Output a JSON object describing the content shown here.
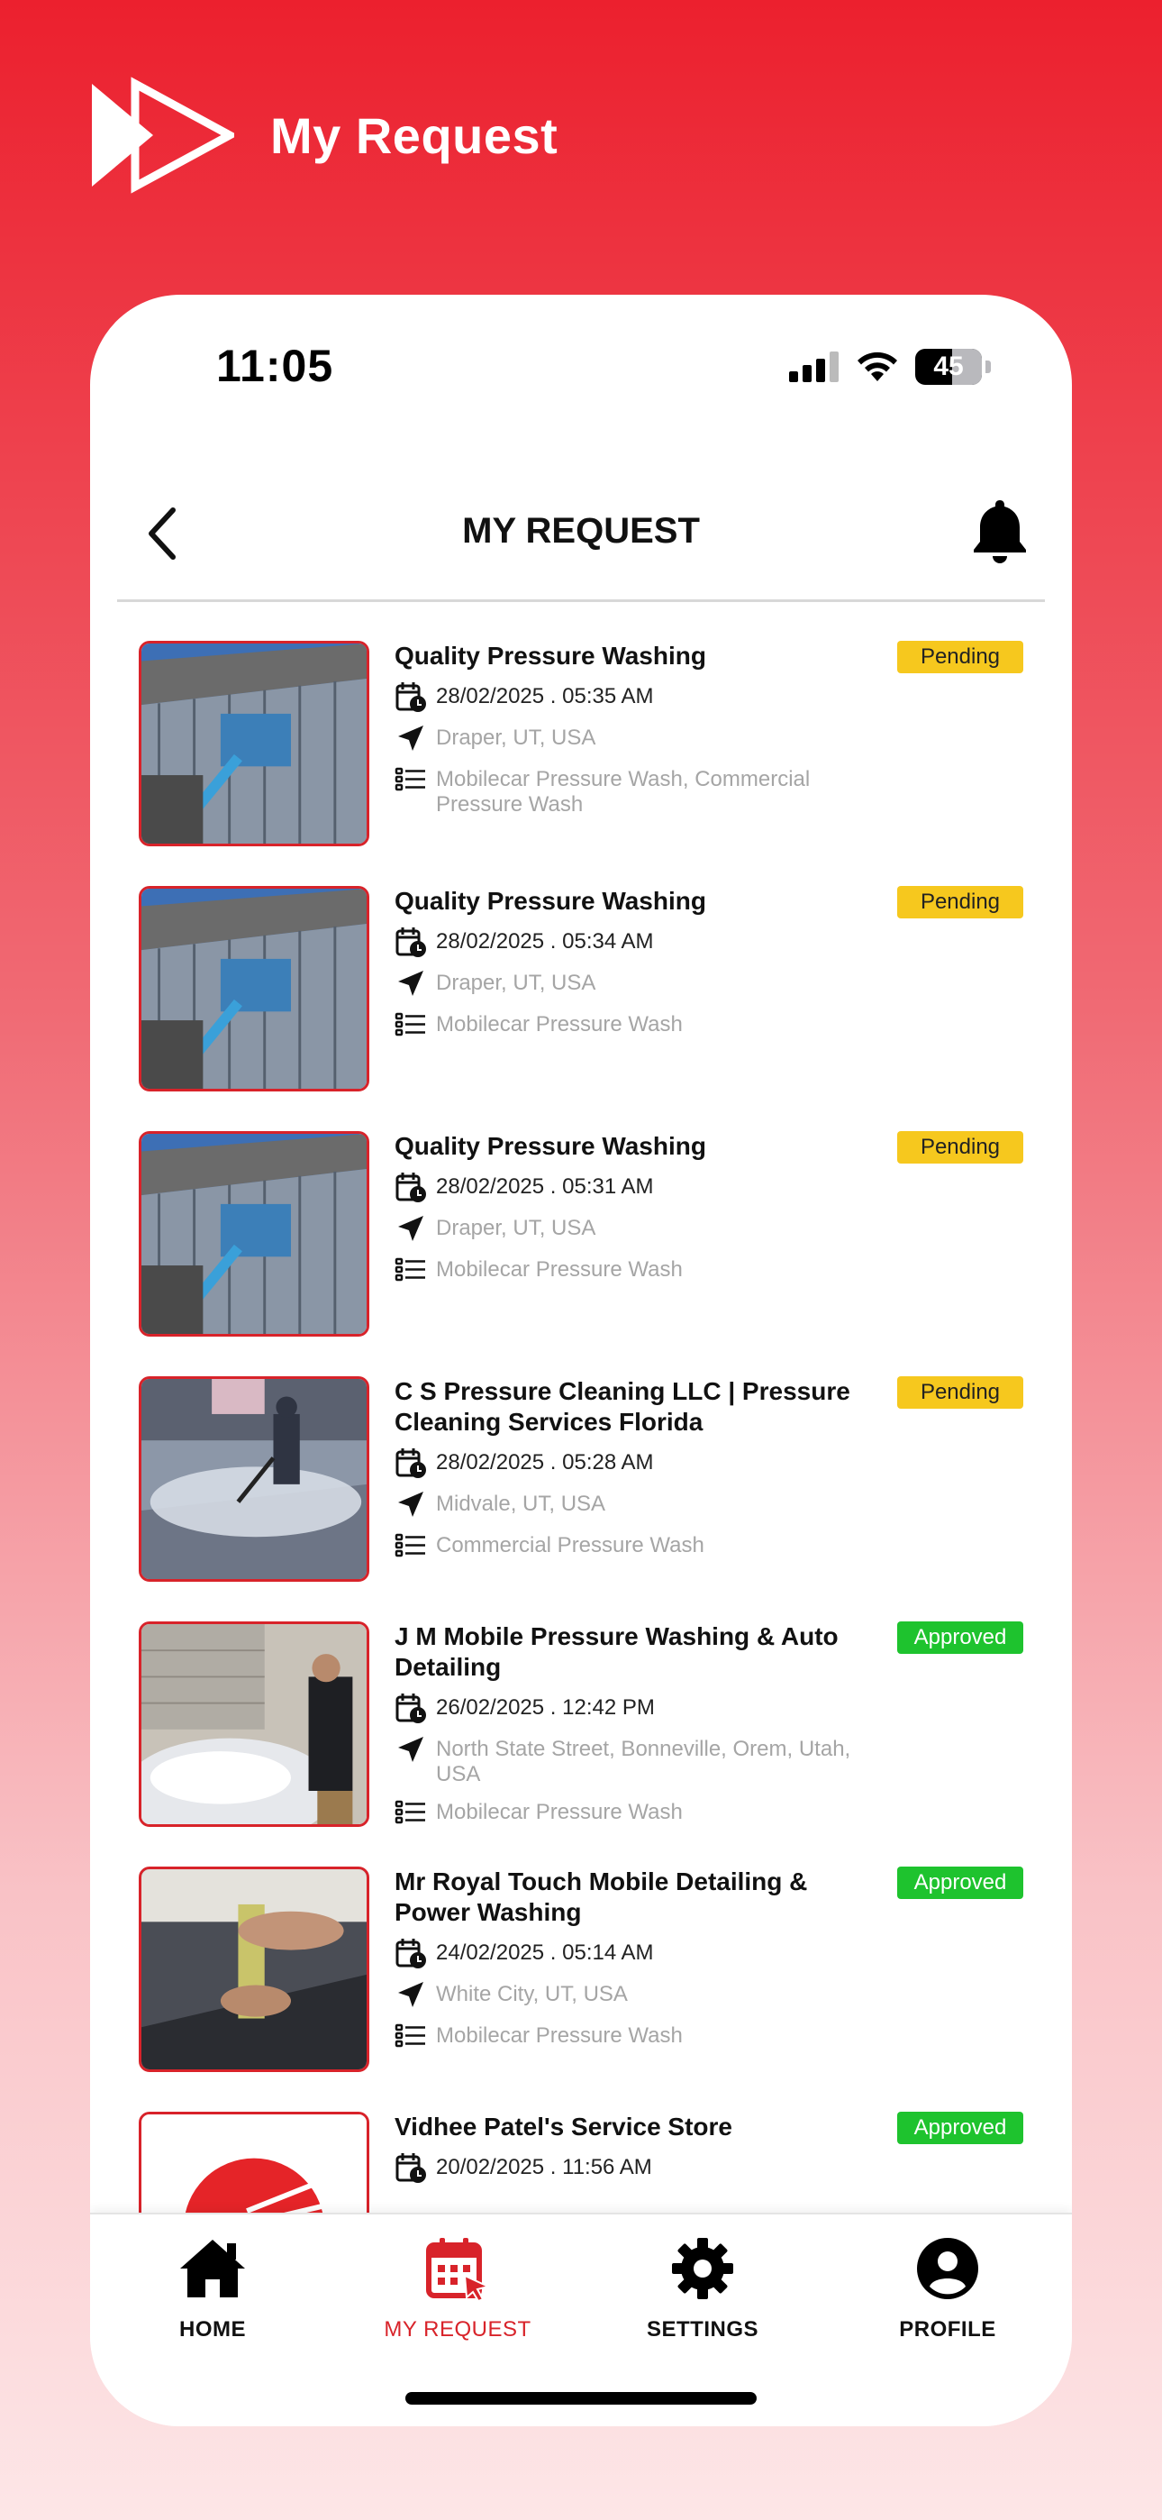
{
  "promo": {
    "title": "My Request"
  },
  "status_bar": {
    "time": "11:05",
    "battery": "45"
  },
  "header": {
    "title": "MY REQUEST"
  },
  "requests": [
    {
      "title": "Quality Pressure Washing",
      "datetime": "28/02/2025 . 05:35 AM",
      "location": "Draper, UT, USA",
      "services": "Mobilecar Pressure Wash, Commercial Pressure Wash",
      "status": "Pending"
    },
    {
      "title": "Quality Pressure Washing",
      "datetime": "28/02/2025 . 05:34 AM",
      "location": "Draper, UT, USA",
      "services": "Mobilecar Pressure Wash",
      "status": "Pending"
    },
    {
      "title": "Quality Pressure Washing",
      "datetime": "28/02/2025 . 05:31 AM",
      "location": "Draper, UT, USA",
      "services": "Mobilecar Pressure Wash",
      "status": "Pending"
    },
    {
      "title": "C S Pressure Cleaning LLC | Pressure Cleaning Services Florida",
      "datetime": "28/02/2025 . 05:28 AM",
      "location": "Midvale, UT, USA",
      "services": "Commercial Pressure Wash",
      "status": "Pending"
    },
    {
      "title": "J M Mobile Pressure Washing & Auto Detailing",
      "datetime": "26/02/2025 . 12:42 PM",
      "location": "North State Street, Bonneville, Orem, Utah, USA",
      "services": "Mobilecar Pressure Wash",
      "status": "Approved"
    },
    {
      "title": "Mr Royal Touch Mobile Detailing & Power Washing",
      "datetime": "24/02/2025 . 05:14 AM",
      "location": "White City, UT, USA",
      "services": "Mobilecar Pressure Wash",
      "status": "Approved"
    },
    {
      "title": "Vidhee Patel's Service Store",
      "datetime": "20/02/2025 . 11:56 AM",
      "location": "",
      "services": "",
      "status": "Approved"
    }
  ],
  "tabbar": {
    "home": "HOME",
    "my_request": "MY REQUEST",
    "settings": "SETTINGS",
    "profile": "PROFILE"
  },
  "colors": {
    "brand": "#ec202e",
    "pending": "#f6c81e",
    "approved": "#1ec32e",
    "active_tab": "#d8232a"
  },
  "icons": [
    "back-chevron-icon",
    "bell-icon",
    "calendar-clock-icon",
    "location-arrow-icon",
    "list-icon",
    "home-icon",
    "calendar-icon",
    "gear-icon",
    "user-circle-icon"
  ]
}
